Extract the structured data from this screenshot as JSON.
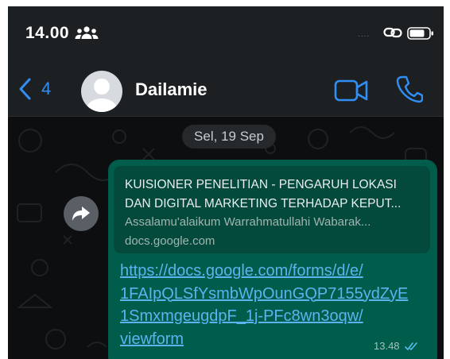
{
  "status_bar": {
    "time": "14.00",
    "people_icon": "people-group-icon",
    "signal": "....",
    "link_icon": "link-icon",
    "battery_icon": "battery-icon"
  },
  "header": {
    "back_count": "4",
    "contact_name": "Dailamie",
    "icons": [
      "chevron-left-icon",
      "avatar",
      "video-camera-icon",
      "phone-icon"
    ]
  },
  "chat": {
    "date_label": "Sel, 19 Sep",
    "message": {
      "preview_title": "KUISIONER PENELITIAN - PENGARUH LOKASI\nDAN DIGITAL MARKETING TERHADAP KEPUT...",
      "preview_description": "Assalamu'alaikum Warrahmatullahi Wabarak...",
      "preview_domain": "docs.google.com",
      "link_text": "https://docs.google.com/forms/d/e/\n1FAIpQLSfYsmbWpOunGQP7155ydZyE\n1SmxmgeugdpF_1j-PFc8wn3oqw/\nviewform",
      "time": "13.48",
      "status": "read"
    }
  },
  "colors": {
    "accent": "#2f8ff5",
    "bubble": "#005c4b",
    "link": "#5ab4f0",
    "header_bg": "#1d2023"
  }
}
